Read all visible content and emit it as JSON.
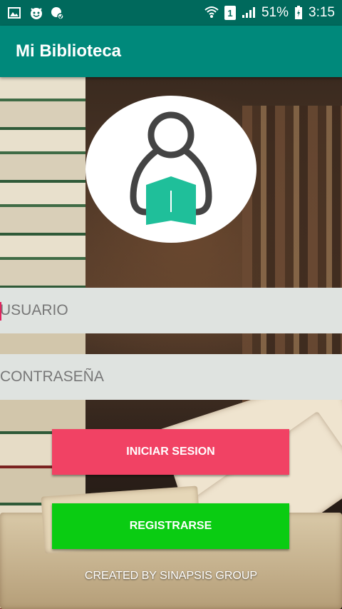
{
  "status_bar": {
    "battery": "51%",
    "time": "3:15",
    "sim_slot": "1"
  },
  "app_bar": {
    "title": "Mi Biblioteca"
  },
  "form": {
    "username_placeholder": "USUARIO",
    "password_placeholder": "CONTRASEÑA"
  },
  "buttons": {
    "login_label": "INICIAR SESION",
    "register_label": "REGISTRARSE"
  },
  "footer": {
    "text": "CREATED BY SINAPSIS GROUP"
  },
  "colors": {
    "status_bar": "#00695c",
    "app_bar": "#00897b",
    "login_button": "#f14264",
    "register_button": "#0acc12",
    "field_bg": "#dfe3e0",
    "logo_book": "#1fbf9a"
  },
  "icons": [
    "gallery-icon",
    "emoji-icon",
    "security-icon",
    "wifi-icon",
    "sim-icon",
    "signal-icon",
    "battery-icon",
    "reader-logo-icon"
  ]
}
